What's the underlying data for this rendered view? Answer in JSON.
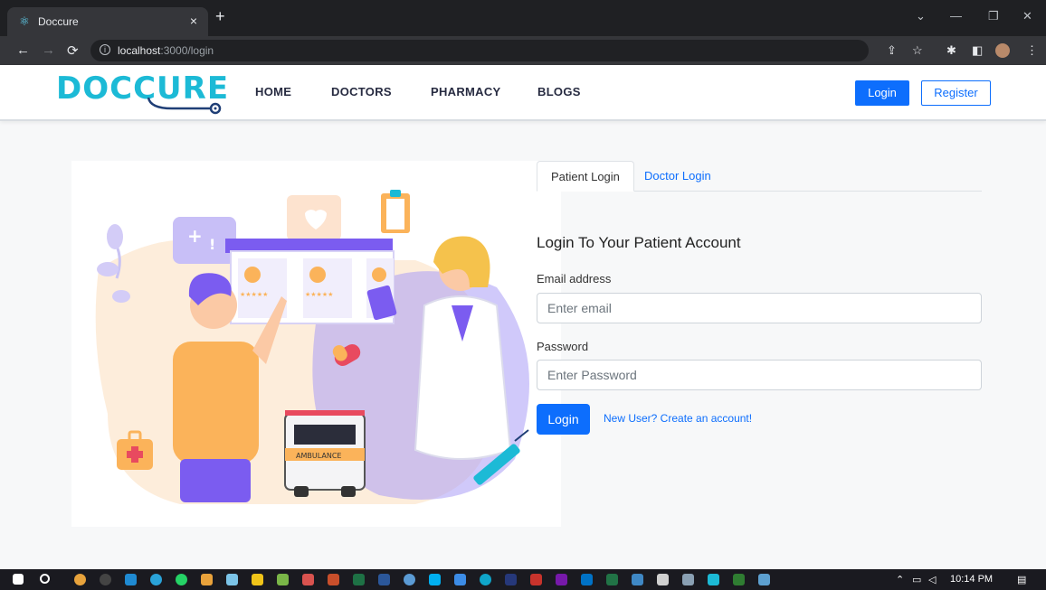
{
  "browser": {
    "tab_title": "Doccure",
    "tab_close": "×",
    "new_tab": "+",
    "url_host": "localhost",
    "url_path": ":3000/login",
    "favicon": "react-icon"
  },
  "site": {
    "logo_text": "DOCCURE",
    "nav": {
      "home": "HOME",
      "doctors": "DOCTORS",
      "pharmacy": "PHARMACY",
      "blogs": "BLOGS"
    },
    "login_button": "Login",
    "register_button": "Register"
  },
  "login": {
    "tabs": {
      "patient": "Patient Login",
      "doctor": "Doctor Login"
    },
    "title": "Login To Your Patient Account",
    "email_label": "Email address",
    "email_placeholder": "Enter email",
    "email_value": "",
    "password_label": "Password",
    "password_placeholder": "Enter Password",
    "password_value": "",
    "submit_button": "Login",
    "signup_link": "New User? Create an account!"
  },
  "illustration": {
    "ambulance_text": "AMBULANCE"
  },
  "taskbar": {
    "time": "10:14 PM"
  },
  "colors": {
    "brand": "#1cbad6",
    "primary": "#0d6efd",
    "illustration_purple": "#7b5cf0",
    "illustration_orange": "#fbb35a"
  }
}
